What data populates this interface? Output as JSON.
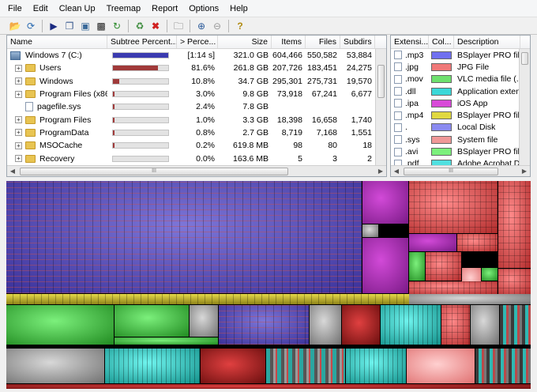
{
  "menu": [
    "File",
    "Edit",
    "Clean Up",
    "Treemap",
    "Report",
    "Options",
    "Help"
  ],
  "toolbar_icons": [
    "open-icon",
    "refresh-icon",
    "select-icon",
    "copy-icon",
    "explore-icon",
    "cmd-icon",
    "refresh-selected-icon",
    "cleanup-icon",
    "delete-icon",
    "new-folder-icon",
    "zoom-in-icon",
    "zoom-out-icon",
    "help-icon"
  ],
  "tree": {
    "columns": [
      "Name",
      "Subtree Percent...",
      "> Perce...",
      "Size",
      "Items",
      "Files",
      "Subdirs"
    ],
    "rows": [
      {
        "name": "Windows 7 (C:)",
        "type": "drive",
        "expander": "",
        "bar": 1.0,
        "bar_color": "#3b3bb0",
        "pct": "[1:14 s]",
        "size": "321.0 GB",
        "items": "604,466",
        "files": "550,582",
        "subdirs": "53,884"
      },
      {
        "name": "Users",
        "type": "folder",
        "expander": "+",
        "bar": 0.816,
        "bar_color": "#a03a3a",
        "pct": "81.6%",
        "size": "261.8 GB",
        "items": "207,726",
        "files": "183,451",
        "subdirs": "24,275"
      },
      {
        "name": "Windows",
        "type": "folder",
        "expander": "+",
        "bar": 0.108,
        "bar_color": "#a03a3a",
        "pct": "10.8%",
        "size": "34.7 GB",
        "items": "295,301",
        "files": "275,731",
        "subdirs": "19,570"
      },
      {
        "name": "Program Files (x86)",
        "type": "folder",
        "expander": "+",
        "bar": 0.03,
        "bar_color": "#a03a3a",
        "pct": "3.0%",
        "size": "9.8 GB",
        "items": "73,918",
        "files": "67,241",
        "subdirs": "6,677"
      },
      {
        "name": "pagefile.sys",
        "type": "file",
        "expander": "",
        "bar": 0.024,
        "bar_color": "#a03a3a",
        "pct": "2.4%",
        "size": "7.8 GB",
        "items": "",
        "files": "",
        "subdirs": ""
      },
      {
        "name": "Program Files",
        "type": "folder",
        "expander": "+",
        "bar": 0.01,
        "bar_color": "#a03a3a",
        "pct": "1.0%",
        "size": "3.3 GB",
        "items": "18,398",
        "files": "16,658",
        "subdirs": "1,740"
      },
      {
        "name": "ProgramData",
        "type": "folder",
        "expander": "+",
        "bar": 0.008,
        "bar_color": "#a03a3a",
        "pct": "0.8%",
        "size": "2.7 GB",
        "items": "8,719",
        "files": "7,168",
        "subdirs": "1,551"
      },
      {
        "name": "MSOCache",
        "type": "folder",
        "expander": "+",
        "bar": 0.002,
        "bar_color": "#a03a3a",
        "pct": "0.2%",
        "size": "619.8 MB",
        "items": "98",
        "files": "80",
        "subdirs": "18"
      },
      {
        "name": "Recovery",
        "type": "folder",
        "expander": "+",
        "bar": 0.0,
        "bar_color": "#a03a3a",
        "pct": "0.0%",
        "size": "163.6 MB",
        "items": "5",
        "files": "3",
        "subdirs": "2"
      }
    ],
    "scroll_thumb_label": "III"
  },
  "extensions": {
    "columns": [
      "Extensi...",
      "Col...",
      "Description"
    ],
    "rows": [
      {
        "ext": ".mp3",
        "color": "#7070f0",
        "desc": "BSplayer PRO file"
      },
      {
        "ext": ".jpg",
        "color": "#f07878",
        "desc": "JPG File"
      },
      {
        "ext": ".mov",
        "color": "#6ee06e",
        "desc": "VLC media file (.m"
      },
      {
        "ext": ".dll",
        "color": "#3ad8d8",
        "desc": "Application extens"
      },
      {
        "ext": ".ipa",
        "color": "#d84ad8",
        "desc": "iOS App"
      },
      {
        "ext": ".mp4",
        "color": "#e0d840",
        "desc": "BSplayer PRO file"
      },
      {
        "ext": ".",
        "color": "#8a8af0",
        "desc": "Local Disk"
      },
      {
        "ext": ".sys",
        "color": "#f09898",
        "desc": "System file"
      },
      {
        "ext": ".avi",
        "color": "#7cf07c",
        "desc": "BSplayer PRO file"
      },
      {
        "ext": ".pdf",
        "color": "#50e0e0",
        "desc": "Adobe Acrobat Do"
      }
    ],
    "scroll_thumb_label": "III"
  }
}
